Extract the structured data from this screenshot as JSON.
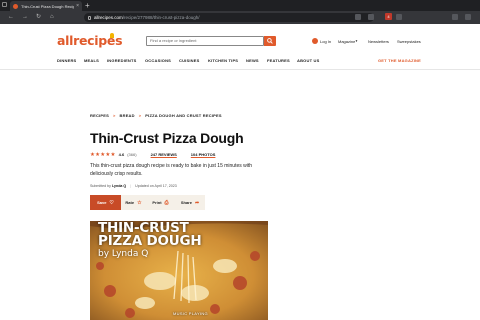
{
  "browser": {
    "tab_title": "Thin-Crust Pizza Dough Recip",
    "tab_close": "×",
    "new_tab": "+",
    "url_domain": "allrecipes.com",
    "url_path": "/recipe/277988/thin-crust-pizza-dough/",
    "extension_badge": "4"
  },
  "site": {
    "logo": "allrecipes",
    "search_placeholder": "Find a recipe or ingredient",
    "login": "Log In",
    "magazine": "Magazine",
    "newsletters": "Newsletters",
    "sweepstakes": "Sweepstakes",
    "nav": [
      "DINNERS",
      "MEALS",
      "INGREDIENTS",
      "OCCASIONS",
      "CUISINES",
      "KITCHEN TIPS",
      "NEWS",
      "FEATURES",
      "ABOUT US"
    ],
    "cta": "GET THE MAGAZINE",
    "accent_color": "#e05a2b"
  },
  "breadcrumb": [
    "RECIPES",
    "BREAD",
    "PIZZA DOUGH AND CRUST RECIPES"
  ],
  "breadcrumb_sep": ">",
  "recipe": {
    "title": "Thin-Crust Pizza Dough",
    "stars": "★★★★★",
    "star_rating": 4.6,
    "rating": "4.6",
    "rating_count": "(366)",
    "reviews": "247 REVIEWS",
    "photos": "104 PHOTOS",
    "description": "This thin-crust pizza dough recipe is ready to bake in just 15 minutes with deliciously crisp results.",
    "submitted_label": "Submitted by",
    "author": "Lynda Q",
    "updated": "Updated on April 17, 2023"
  },
  "actions": {
    "save": "Save",
    "rate": "Rate",
    "print": "Print",
    "share": "Share"
  },
  "hero": {
    "title_line1": "THIN-CRUST",
    "title_line2": "PIZZA DOUGH",
    "byline": "by Lynda Q",
    "music": "MUSIC PLAYING"
  }
}
